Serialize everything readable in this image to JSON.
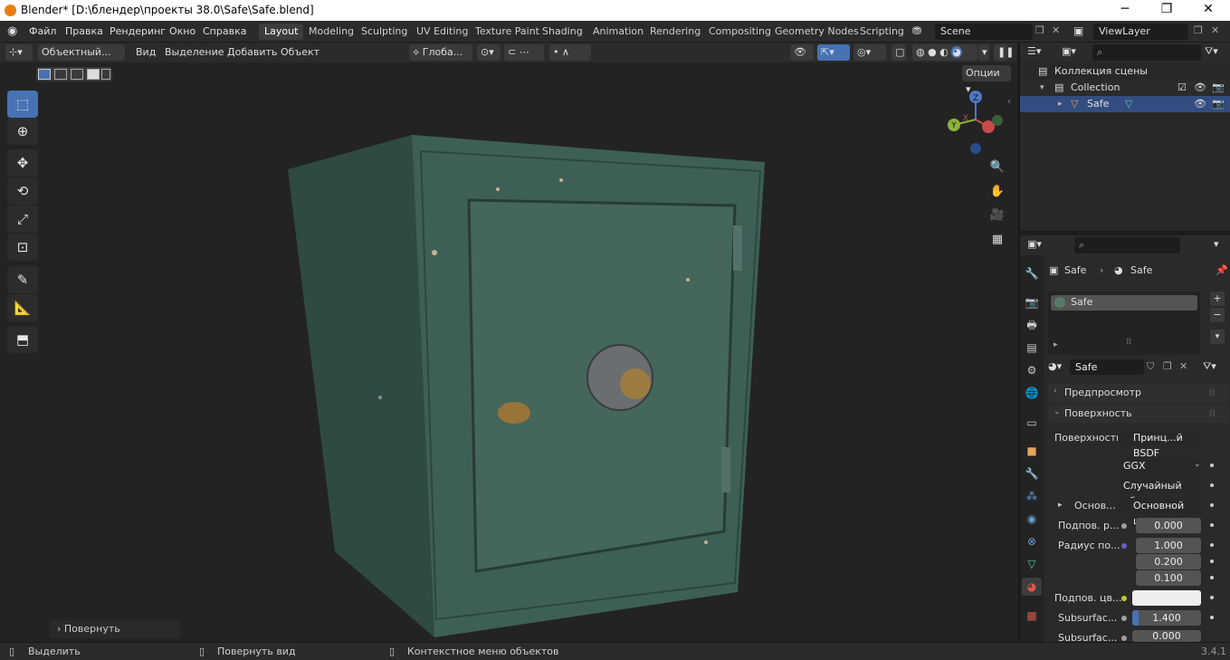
{
  "titlebar": {
    "title": "Blender* [D:\\блендер\\проекты 38.0\\Safe\\Safe.blend]",
    "minimize": "─",
    "maximize": "❐",
    "close": "✕"
  },
  "menus": [
    "Файл",
    "Правка",
    "Рендеринг",
    "Окно",
    "Справка"
  ],
  "workspaces": [
    "Layout",
    "Modeling",
    "Sculpting",
    "UV Editing",
    "Texture Paint",
    "Shading",
    "Animation",
    "Rendering",
    "Compositing",
    "Geometry Nodes",
    "Scripting"
  ],
  "scene": {
    "name": "Scene",
    "view_layer": "ViewLayer"
  },
  "viewport_header": {
    "mode": "Объектный...",
    "view": "Вид",
    "select": "Выделение",
    "add": "Добавить",
    "object": "Объект",
    "transform_orientation": "Глоба...",
    "options": "Опции"
  },
  "last_operator": "Повернуть",
  "gizmo": {
    "x": "X",
    "y": "Y",
    "z": "Z"
  },
  "outliner": {
    "root": "Коллекция сцены",
    "collection": "Collection",
    "object": "Safe"
  },
  "properties": {
    "breadcrumb_object": "Safe",
    "breadcrumb_material": "Safe",
    "slot_name": "Safe",
    "material_name": "Safe",
    "preview_panel": "Предпросмотр",
    "surface_panel": "Поверхность",
    "surface_label": "Поверхность",
    "surface_value": "Принц...й BSDF",
    "distribution": "GGX",
    "subsurface_method": "Случайный об...",
    "base_label": "Основ...",
    "base_value": "Основной цвет",
    "subsurface_label": "Подпов. р...",
    "subsurface_value": "0.000",
    "radius_label": "Радиус по...",
    "radius_values": [
      "1.000",
      "0.200",
      "0.100"
    ],
    "subsurface_color_label": "Подпов. цв...",
    "subsurface_ior_label": "Subsurfac...",
    "subsurface_ior_value": "1.400",
    "subsurface_aniso_label": "Subsurfac...",
    "subsurface_aniso_value": "0.000"
  },
  "statusbar": {
    "select": "Выделить",
    "rotate_view": "Повернуть вид",
    "context_menu": "Контекстное меню объектов",
    "version": "3.4.1"
  },
  "colors": {
    "accent": "#4772b3",
    "header": "#2b2b2b",
    "viewport": "#232323",
    "safe": "#3c5e53"
  }
}
